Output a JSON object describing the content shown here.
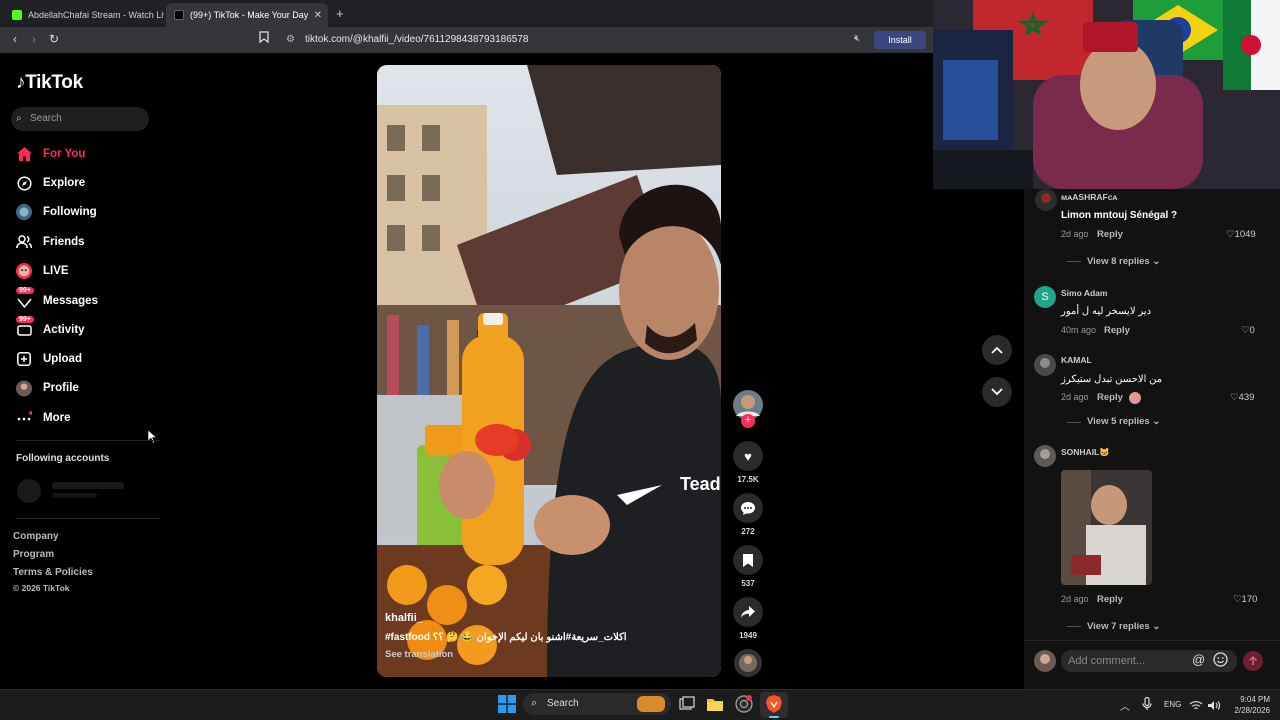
{
  "browser": {
    "tabs": [
      {
        "label": "AbdellahChafai Stream - Watch Live"
      },
      {
        "label": "(99+) TikTok - Make Your Day"
      }
    ],
    "url": "tiktok.com/@khalfii_/video/7611298438793186578",
    "install_label": "Install"
  },
  "sidebar": {
    "logo": "TikTok",
    "search_placeholder": "Search",
    "items": [
      {
        "label": "For You",
        "icon": "home-icon"
      },
      {
        "label": "Explore",
        "icon": "compass-icon"
      },
      {
        "label": "Following",
        "icon": "following-icon"
      },
      {
        "label": "Friends",
        "icon": "friends-icon"
      },
      {
        "label": "LIVE",
        "icon": "live-icon"
      },
      {
        "label": "Messages",
        "icon": "messages-icon",
        "badge": "99+"
      },
      {
        "label": "Activity",
        "icon": "activity-icon",
        "badge": "99+"
      },
      {
        "label": "Upload",
        "icon": "upload-icon"
      },
      {
        "label": "Profile",
        "icon": "profile-icon"
      },
      {
        "label": "More",
        "icon": "more-icon"
      }
    ],
    "following_heading": "Following accounts",
    "footer": [
      "Company",
      "Program",
      "Terms & Policies",
      "© 2026 TikTok"
    ]
  },
  "video": {
    "author": "khalfii_",
    "caption": "#fastfood اكلات_سريعة#اشنو بان ليكم الإخوان 😂 🤔 ؟؟",
    "see_translation": "See translation",
    "likes": "17.5K",
    "comments": "272",
    "saves": "537",
    "shares": "1949"
  },
  "comments": [
    {
      "user": "ᴍᴀASHRAFᴄᴀ",
      "text": "Limon mntouj Sénégal ?",
      "time": "2d ago",
      "reply": "Reply",
      "likes": "1049",
      "more": "View 8 replies"
    },
    {
      "user": "Simo Adam",
      "avatar_letter": "S",
      "text": "دير لايسخر ليه ل أمور",
      "time": "40m ago",
      "reply": "Reply",
      "likes": "0"
    },
    {
      "user": "KAMAL",
      "text": "من الاحسن تبدل ستيكرز",
      "time": "2d ago",
      "reply": "Reply",
      "likes": "439",
      "more": "View 5 replies"
    },
    {
      "user": "SONHAIL🐱",
      "text": "",
      "time": "2d ago",
      "reply": "Reply",
      "likes": "170",
      "more": "View 7 replies"
    }
  ],
  "add_comment_placeholder": "Add comment...",
  "taskbar": {
    "search_label": "Search",
    "language": "ENG",
    "time": "9:04 PM",
    "date": "2/28/2026"
  },
  "colors": {
    "accent": "#fe2c55",
    "install_bg": "#3c4780",
    "taskbar": "#1c1c1c"
  }
}
